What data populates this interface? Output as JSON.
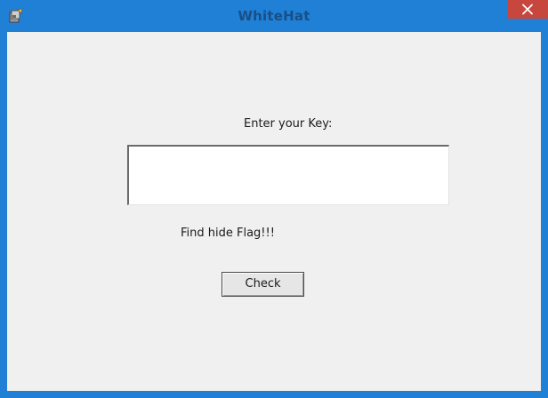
{
  "window": {
    "title": "WhiteHat",
    "close_symbol": "✕",
    "app_icon": "app-icon",
    "colors": {
      "titlebar": "#1f80d6",
      "title_text": "#1a4f86",
      "close_button": "#c7463e",
      "client": "#f0f0f0"
    }
  },
  "form": {
    "key_label": "Enter your Key:",
    "key_value": "",
    "key_placeholder": "",
    "flag_label": "Find hide Flag!!!",
    "check_label": "Check"
  }
}
